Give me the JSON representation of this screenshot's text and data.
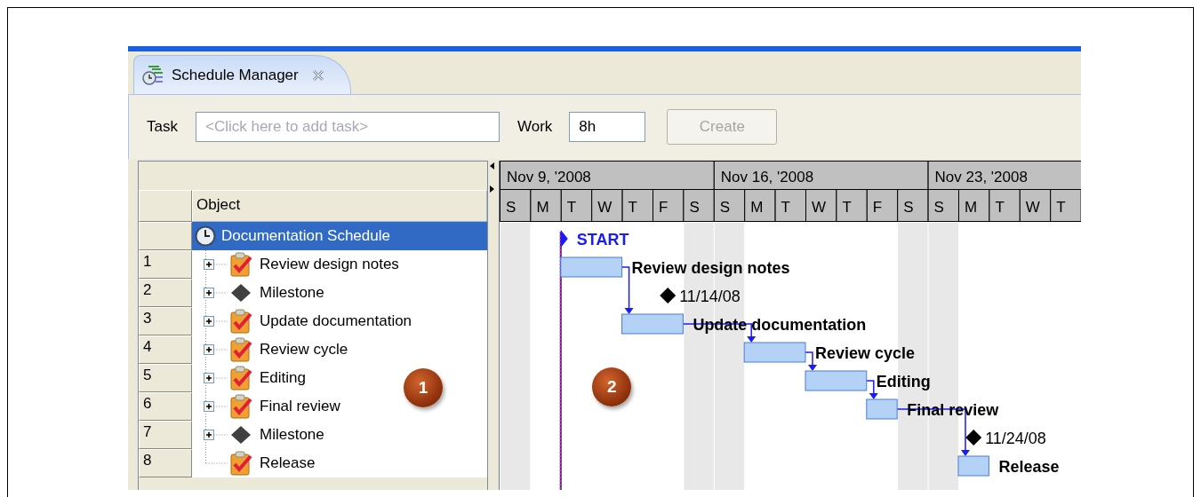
{
  "tab": {
    "title": "Schedule Manager",
    "selected": true
  },
  "toolbar": {
    "task_label": "Task",
    "task_field": {
      "placeholder": "<Click here to add task>"
    },
    "work_label": "Work",
    "work_field": {
      "value": "8h"
    },
    "create_button": {
      "label": "Create",
      "disabled": true
    }
  },
  "tree": {
    "column": "Object",
    "root": {
      "label": "Documentation Schedule",
      "selected": true
    },
    "rows": [
      {
        "number": "1",
        "label": "Review design notes",
        "kind": "task",
        "expandable": true
      },
      {
        "number": "2",
        "label": "Milestone",
        "kind": "milestone",
        "expandable": true
      },
      {
        "number": "3",
        "label": "Update documentation",
        "kind": "task",
        "expandable": true
      },
      {
        "number": "4",
        "label": "Review cycle",
        "kind": "task",
        "expandable": true
      },
      {
        "number": "5",
        "label": "Editing",
        "kind": "task",
        "expandable": true
      },
      {
        "number": "6",
        "label": "Final review",
        "kind": "task",
        "expandable": true
      },
      {
        "number": "7",
        "label": "Milestone",
        "kind": "milestone",
        "expandable": true
      },
      {
        "number": "8",
        "label": "Release",
        "kind": "task",
        "expandable": false
      }
    ]
  },
  "gantt": {
    "weeks": [
      "Nov 9,  '2008",
      "Nov 16,  '2008",
      "Nov 23,  '2008"
    ],
    "days": [
      "S",
      "M",
      "T",
      "W",
      "T",
      "F",
      "S",
      "S",
      "M",
      "T",
      "W",
      "T",
      "F",
      "S",
      "S",
      "M",
      "T",
      "W",
      "T"
    ],
    "start_label": "START",
    "items": [
      {
        "kind": "task",
        "label": "Review design notes"
      },
      {
        "kind": "milestone",
        "label": "11/14/08"
      },
      {
        "kind": "task",
        "label": "Update documentation"
      },
      {
        "kind": "task",
        "label": "Review cycle"
      },
      {
        "kind": "task",
        "label": "Editing"
      },
      {
        "kind": "task",
        "label": "Final review"
      },
      {
        "kind": "milestone",
        "label": "11/24/08"
      },
      {
        "kind": "task",
        "label": "Release"
      }
    ]
  },
  "callouts": [
    {
      "label": "1"
    },
    {
      "label": "2"
    }
  ]
}
